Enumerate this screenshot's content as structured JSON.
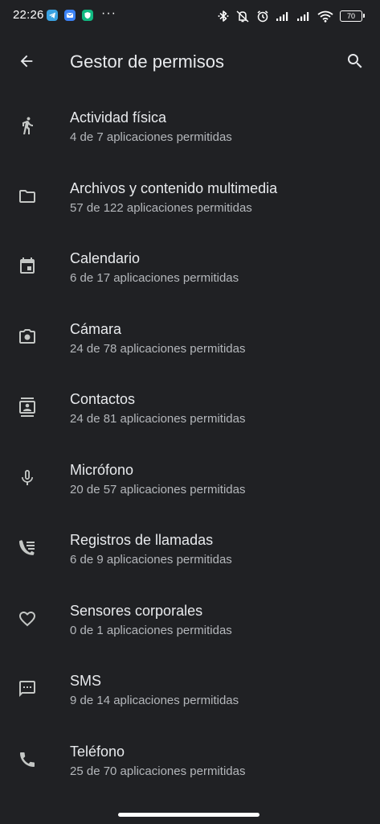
{
  "status_bar": {
    "time": "22:26",
    "more": "···",
    "battery": "70",
    "notification_icons": [
      "telegram-icon",
      "mail-icon",
      "shield-icon"
    ],
    "system_icons": [
      "bluetooth-icon",
      "vibrate-off-icon",
      "alarm-icon",
      "signal-icon",
      "signal-icon",
      "wifi-icon",
      "battery-icon"
    ]
  },
  "app_bar": {
    "title": "Gestor de permisos",
    "back_icon": "arrow-back-icon",
    "search_icon": "search-icon"
  },
  "permissions": [
    {
      "title": "Actividad física",
      "subtitle": "4 de 7 aplicaciones permitidas",
      "icon": "walking-person-icon"
    },
    {
      "title": "Archivos y contenido multimedia",
      "subtitle": "57 de 122 aplicaciones permitidas",
      "icon": "folder-icon"
    },
    {
      "title": "Calendario",
      "subtitle": "6 de 17 aplicaciones permitidas",
      "icon": "calendar-icon"
    },
    {
      "title": "Cámara",
      "subtitle": "24 de 78 aplicaciones permitidas",
      "icon": "camera-icon"
    },
    {
      "title": "Contactos",
      "subtitle": "24 de 81 aplicaciones permitidas",
      "icon": "contacts-icon"
    },
    {
      "title": "Micrófono",
      "subtitle": "20 de 57 aplicaciones permitidas",
      "icon": "microphone-icon"
    },
    {
      "title": "Registros de llamadas",
      "subtitle": "6 de 9 aplicaciones permitidas",
      "icon": "call-log-icon"
    },
    {
      "title": "Sensores corporales",
      "subtitle": "0 de 1 aplicaciones permitidas",
      "icon": "heart-icon"
    },
    {
      "title": "SMS",
      "subtitle": "9 de 14 aplicaciones permitidas",
      "icon": "sms-icon"
    },
    {
      "title": "Teléfono",
      "subtitle": "25 de 70 aplicaciones permitidas",
      "icon": "phone-icon"
    }
  ],
  "colors": {
    "background": "#202124",
    "text_primary": "#e8eaed",
    "text_secondary": "#b4b7bb",
    "icon": "#c4c7c5"
  }
}
